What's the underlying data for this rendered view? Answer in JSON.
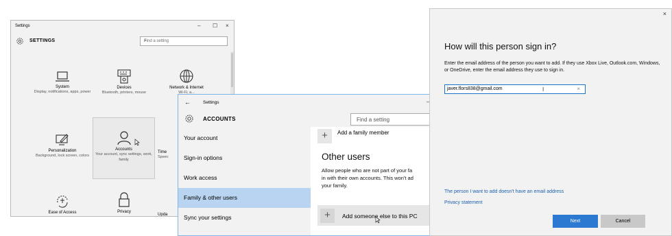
{
  "settings_window": {
    "title": "Settings",
    "controls": [
      "–",
      "☐",
      "×"
    ],
    "header": "SETTINGS",
    "search_placeholder": "Find a setting",
    "tiles": [
      {
        "name": "System",
        "desc": "Display, notifications, apps, power",
        "icon": "laptop-icon"
      },
      {
        "name": "Devices",
        "desc": "Bluetooth, printers, mouse",
        "icon": "keyboard-device-icon"
      },
      {
        "name": "Network & Internet",
        "desc": "Wi-Fi, a...",
        "icon": "globe-icon"
      },
      {
        "name": "Personalization",
        "desc": "Background, lock screen, colors",
        "icon": "pen-monitor-icon"
      },
      {
        "name": "Accounts",
        "desc": "Your account, sync settings, work, family",
        "icon": "person-icon"
      },
      {
        "name": "Time",
        "desc": "Speec",
        "icon": ""
      },
      {
        "name": "Ease of Access",
        "desc": "",
        "icon": "ease-of-access-icon"
      },
      {
        "name": "Privacy",
        "desc": "",
        "icon": "lock-icon"
      },
      {
        "name": "Upda",
        "desc": "",
        "icon": ""
      }
    ]
  },
  "accounts_window": {
    "back": "←",
    "title": "Settings",
    "minimize": "–",
    "header": "ACCOUNTS",
    "search_placeholder": "Find a setting",
    "nav": [
      "Your account",
      "Sign-in options",
      "Work access",
      "Family & other users",
      "Sync your settings"
    ],
    "active_nav": "Family & other users",
    "add_family": "Add a family member",
    "other_users_heading": "Other users",
    "other_users_desc": [
      "Allow people who are not part of your fa",
      "in with their own accounts. This won't ad",
      "your family."
    ],
    "add_someone": "Add someone else to this PC"
  },
  "dialog": {
    "close": "×",
    "heading": "How will this person sign in?",
    "instructions": "Enter the email address of the person you want to add. If they use Xbox Live, Outlook.com, Windows, or OneDrive, enter the email address they use to sign in.",
    "email_value": "javer.flors838@gmail.com",
    "clear": "×",
    "no_email_link": "The person I want to add doesn't have an email address",
    "privacy_link": "Privacy statement",
    "next_label": "Next",
    "cancel_label": "Cancel"
  },
  "colors": {
    "accent": "#2b79d1",
    "nav_active": "#b8d4f0",
    "link": "#1a5fae"
  }
}
